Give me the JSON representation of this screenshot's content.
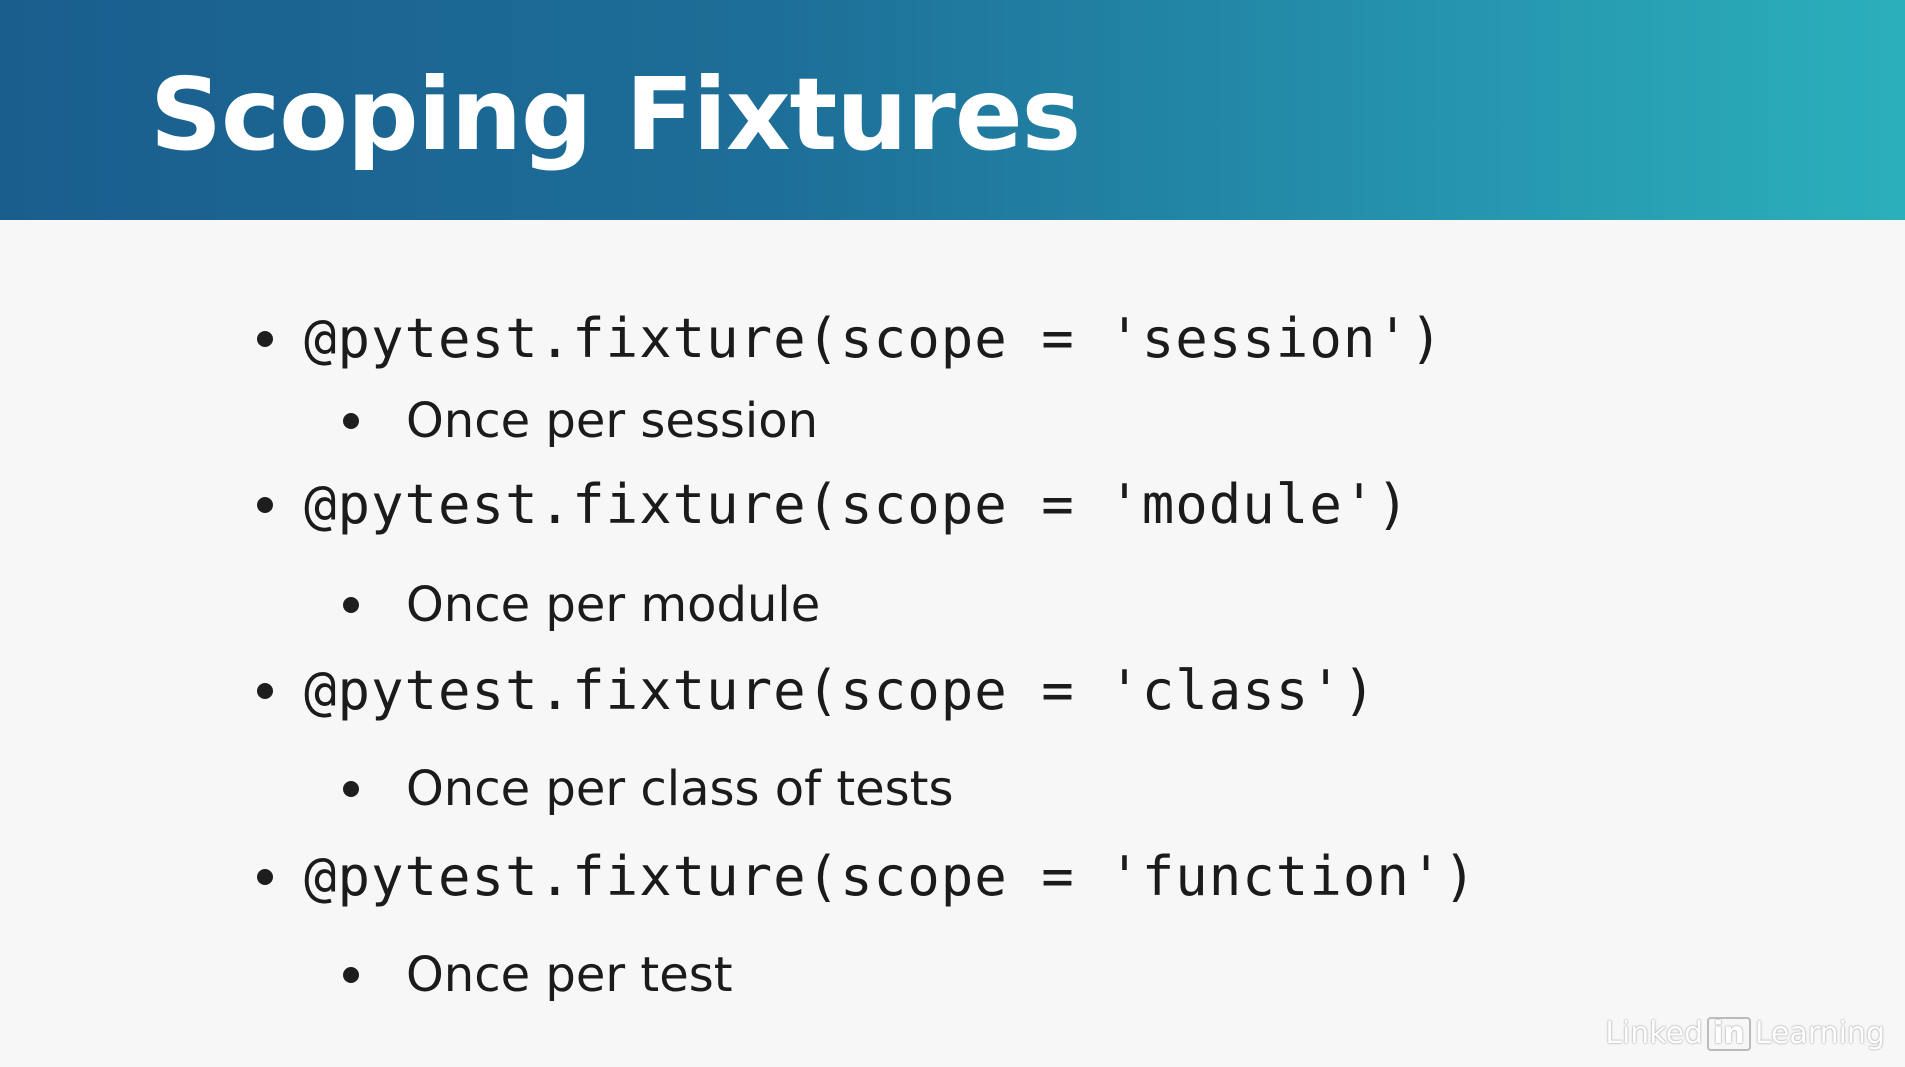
{
  "slide": {
    "title": "Scoping Fixtures",
    "items": [
      {
        "code": "@pytest.fixture(scope = 'session')",
        "desc": "Once per session"
      },
      {
        "code": "@pytest.fixture(scope = 'module')",
        "desc": "Once per module"
      },
      {
        "code": "@pytest.fixture(scope = 'class')",
        "desc": "Once per class of tests"
      },
      {
        "code": "@pytest.fixture(scope = 'function')",
        "desc": "Once per test"
      }
    ]
  },
  "watermark": {
    "pre": "Linked",
    "box": "in",
    "post": "Learning"
  },
  "colors": {
    "header_start": "#1a5e8e",
    "header_end": "#2bb0bb",
    "background": "#f7f7f7",
    "text": "#1b1b1b"
  }
}
